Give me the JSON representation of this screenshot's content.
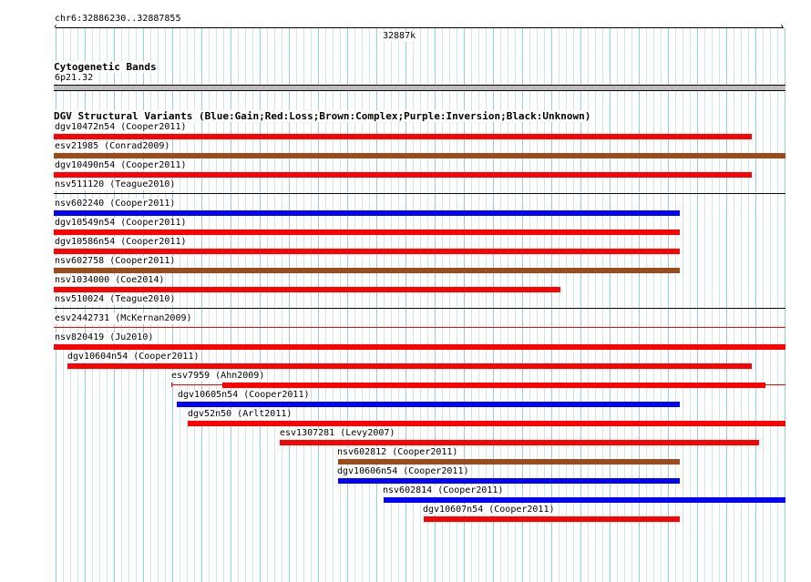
{
  "ruler": {
    "position_label": "chr6:32886230..32887855",
    "center_label": "32887k"
  },
  "cytobands": {
    "title": "Cytogenetic Bands",
    "band": "6p21.32"
  },
  "dgv": {
    "title": "DGV Structural Variants (Blue:Gain;Red:Loss;Brown:Complex;Purple:Inversion;Black:Unknown)",
    "colors": {
      "gain": "#0000ff",
      "loss": "#ff0000",
      "complex": "#994c1e"
    },
    "tracks": [
      {
        "name": "dgv10472n54 (Cooper2011)",
        "type": "loss",
        "start": 0.0,
        "end": 0.954
      },
      {
        "name": "esv21985 (Conrad2009)",
        "type": "complex",
        "start": 0.0,
        "end": 1.0
      },
      {
        "name": "dgv10490n54 (Cooper2011)",
        "type": "loss",
        "start": 0.0,
        "end": 0.954
      },
      {
        "name": "nsv511120 (Teague2010)",
        "type": "none"
      },
      {
        "name": "nsv602240 (Cooper2011)",
        "type": "gain",
        "start": 0.0,
        "end": 0.855
      },
      {
        "name": "dgv10549n54 (Cooper2011)",
        "type": "loss",
        "start": 0.0,
        "end": 0.855
      },
      {
        "name": "dgv10586n54 (Cooper2011)",
        "type": "loss",
        "start": 0.0,
        "end": 0.855
      },
      {
        "name": "nsv602758 (Cooper2011)",
        "type": "complex",
        "start": 0.0,
        "end": 0.855
      },
      {
        "name": "nsv1034000 (Coe2014)",
        "type": "loss",
        "start": 0.0,
        "end": 0.692
      },
      {
        "name": "nsv510024 (Teague2010)",
        "type": "none"
      },
      {
        "name": "esv2442731 (McKernan2009)",
        "type": "thin",
        "start": 0.0,
        "end": 1.0
      },
      {
        "name": "nsv820419 (Ju2010)",
        "type": "loss",
        "start": 0.0,
        "end": 1.0
      },
      {
        "name": "dgv10604n54 (Cooper2011)",
        "type": "loss",
        "start": 0.019,
        "end": 0.954
      },
      {
        "name": "esv7959 (Ahn2009)",
        "type": "loss-split",
        "start": 0.231,
        "end": 0.973
      },
      {
        "name": "dgv10605n54 (Cooper2011)",
        "type": "gain",
        "start": 0.168,
        "end": 0.855
      },
      {
        "name": "dgv52n50 (Arlt2011)",
        "type": "loss",
        "start": 0.183,
        "end": 1.0
      },
      {
        "name": "esv1307281 (Levy2007)",
        "type": "loss",
        "start": 0.309,
        "end": 0.964
      },
      {
        "name": "nsv602812 (Cooper2011)",
        "type": "complex",
        "start": 0.389,
        "end": 0.855
      },
      {
        "name": "dgv10606n54 (Cooper2011)",
        "type": "gain",
        "start": 0.389,
        "end": 0.855
      },
      {
        "name": "nsv602814 (Cooper2011)",
        "type": "gain",
        "start": 0.451,
        "end": 1.0
      },
      {
        "name": "dgv10607n54 (Cooper2011)",
        "type": "loss",
        "start": 0.505,
        "end": 0.855
      }
    ]
  }
}
